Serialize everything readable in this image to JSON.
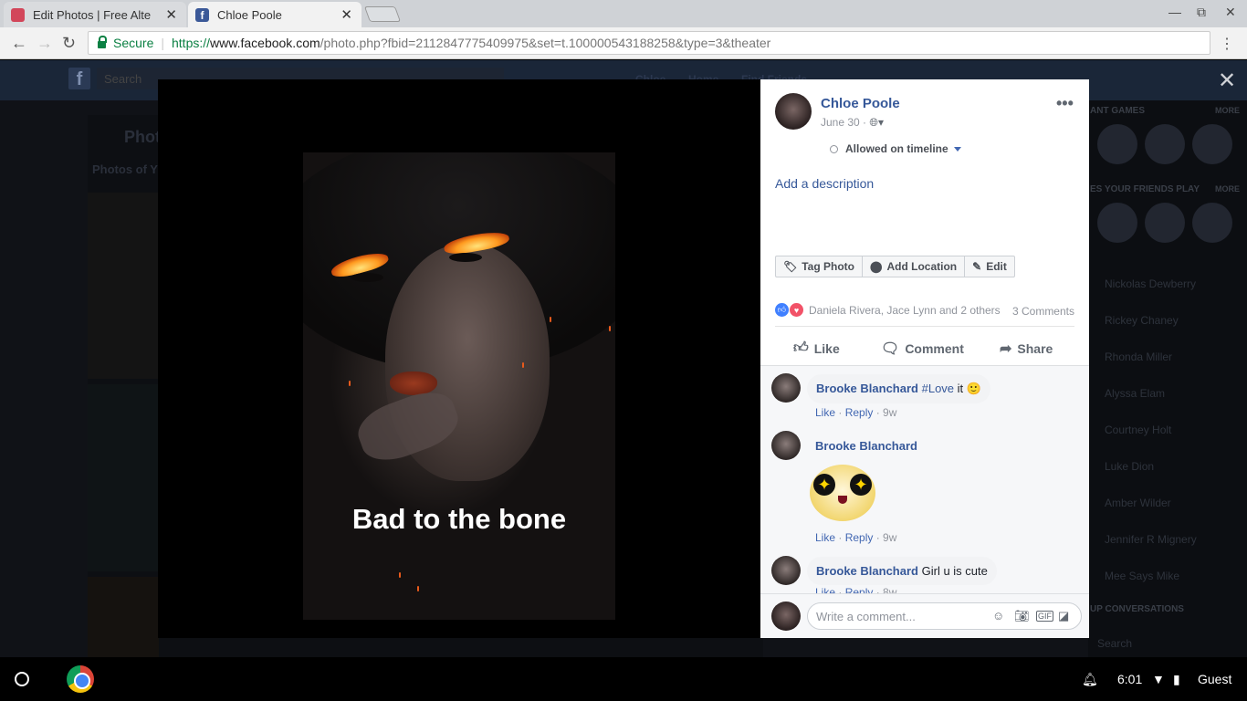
{
  "browser": {
    "tabs": [
      {
        "title": "Edit Photos | Free Alterna",
        "active": false
      },
      {
        "title": "Chloe Poole",
        "active": true
      }
    ],
    "secure_label": "Secure",
    "url_https": "https://",
    "url_host": "www.facebook.com",
    "url_path": "/photo.php?fbid=2112847775409975&set=t.100000543188258&type=3&theater"
  },
  "background_page": {
    "search_placeholder": "Search",
    "header_user": "Chloe",
    "header_home": "Home",
    "header_find": "Find Friends",
    "photos_title": "Phot",
    "photos_sub": "Photos of Y",
    "instant_games": "ANT GAMES",
    "games_friends": "ES YOUR FRIENDS PLAY",
    "more": "MORE",
    "contacts": [
      "Nickolas Dewberry",
      "Rickey Chaney",
      "Rhonda Miller",
      "Alyssa Elam",
      "Courtney Holt",
      "Luke Dion",
      "Amber Wilder",
      "Jennifer R Mignery",
      "Mee Says Mike"
    ],
    "group_conversations": "UP CONVERSATIONS",
    "contact_search": "Search"
  },
  "photo": {
    "caption": "Bad to the bone"
  },
  "post": {
    "author": "Chloe Poole",
    "date": "June 30 ·",
    "timeline_status": "Allowed on timeline",
    "add_description": "Add a description",
    "buttons": {
      "tag": "Tag Photo",
      "location": "Add Location",
      "edit": "Edit"
    },
    "reactions_text": "Daniela Rivera, Jace Lynn and 2 others",
    "comment_count": "3 Comments",
    "actions": {
      "like": "Like",
      "comment": "Comment",
      "share": "Share"
    }
  },
  "comments": [
    {
      "author": "Brooke Blanchard",
      "hashtag": "#Love",
      "text": " it ",
      "emoji": "🙂",
      "like": "Like",
      "reply": "Reply",
      "time": "9w"
    },
    {
      "author": "Brooke Blanchard",
      "text": "",
      "like": "Like",
      "reply": "Reply",
      "time": "9w"
    },
    {
      "author": "Brooke Blanchard",
      "text": "Girl u is cute",
      "like": "Like",
      "reply": "Reply",
      "time": "8w"
    }
  ],
  "write_comment_placeholder": "Write a comment...",
  "taskbar": {
    "time": "6:01",
    "user": "Guest"
  },
  "colors": {
    "facebook_blue": "#365899",
    "link_blue": "#4267b2",
    "like_blue": "#4080ff",
    "love_red": "#f25268"
  }
}
